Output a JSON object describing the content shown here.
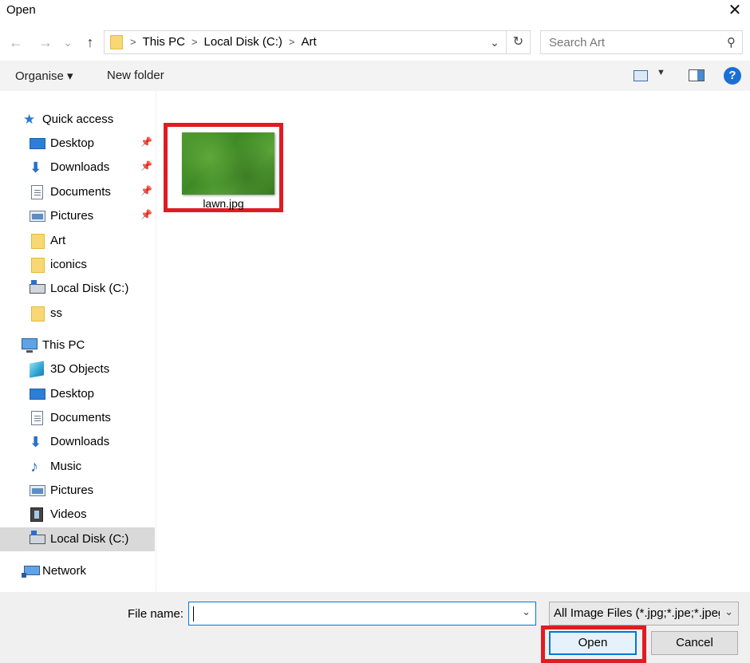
{
  "window": {
    "title": "Open",
    "close_glyph": "✕"
  },
  "navigation": {
    "back_glyph": "←",
    "forward_glyph": "→",
    "recent_glyph": "⌄",
    "up_glyph": "↑",
    "breadcrumb": [
      {
        "label": "This PC"
      },
      {
        "label": "Local Disk (C:)"
      },
      {
        "label": "Art"
      }
    ],
    "address_dropdown_glyph": "⌄",
    "refresh_glyph": "↻",
    "search_placeholder": "Search Art",
    "search_glyph": "⚲"
  },
  "toolbar": {
    "organise_label": "Organise ▾",
    "new_folder_label": "New folder",
    "view_dropdown_glyph": "▼",
    "help_glyph": "?"
  },
  "sidebar": {
    "quick_access": {
      "label": "Quick access",
      "items": [
        {
          "label": "Desktop",
          "icon": "desktop-icon",
          "pinned": true
        },
        {
          "label": "Downloads",
          "icon": "downloads-icon",
          "pinned": true
        },
        {
          "label": "Documents",
          "icon": "documents-icon",
          "pinned": true
        },
        {
          "label": "Pictures",
          "icon": "pictures-icon",
          "pinned": true
        },
        {
          "label": "Art",
          "icon": "folder-icon",
          "pinned": false
        },
        {
          "label": "iconics",
          "icon": "folder-icon",
          "pinned": false
        },
        {
          "label": "Local Disk (C:)",
          "icon": "drive-icon",
          "pinned": false
        },
        {
          "label": "ss",
          "icon": "folder-icon",
          "pinned": false
        }
      ]
    },
    "this_pc": {
      "label": "This PC",
      "items": [
        {
          "label": "3D Objects",
          "icon": "3d-objects-icon"
        },
        {
          "label": "Desktop",
          "icon": "desktop-icon"
        },
        {
          "label": "Documents",
          "icon": "documents-icon"
        },
        {
          "label": "Downloads",
          "icon": "downloads-icon"
        },
        {
          "label": "Music",
          "icon": "music-icon"
        },
        {
          "label": "Pictures",
          "icon": "pictures-icon"
        },
        {
          "label": "Videos",
          "icon": "videos-icon"
        },
        {
          "label": "Local Disk (C:)",
          "icon": "drive-icon",
          "selected": true
        }
      ]
    },
    "network": {
      "label": "Network"
    },
    "pin_glyph": "📌",
    "star_glyph": "★",
    "download_glyph": "⬇",
    "music_glyph": "♪"
  },
  "files": [
    {
      "name": "lawn.jpg",
      "highlighted": true
    }
  ],
  "footer": {
    "file_name_label": "File name:",
    "file_name_value": "",
    "dropdown_glyph": "⌄",
    "file_type_value": "All Image Files (*.jpg;*.jpe;*.jpeg",
    "open_label": "Open",
    "cancel_label": "Cancel"
  },
  "colors": {
    "highlight_border": "#e01b24",
    "accent": "#0078d7",
    "selected_nav_bg": "#d9d9d9"
  }
}
